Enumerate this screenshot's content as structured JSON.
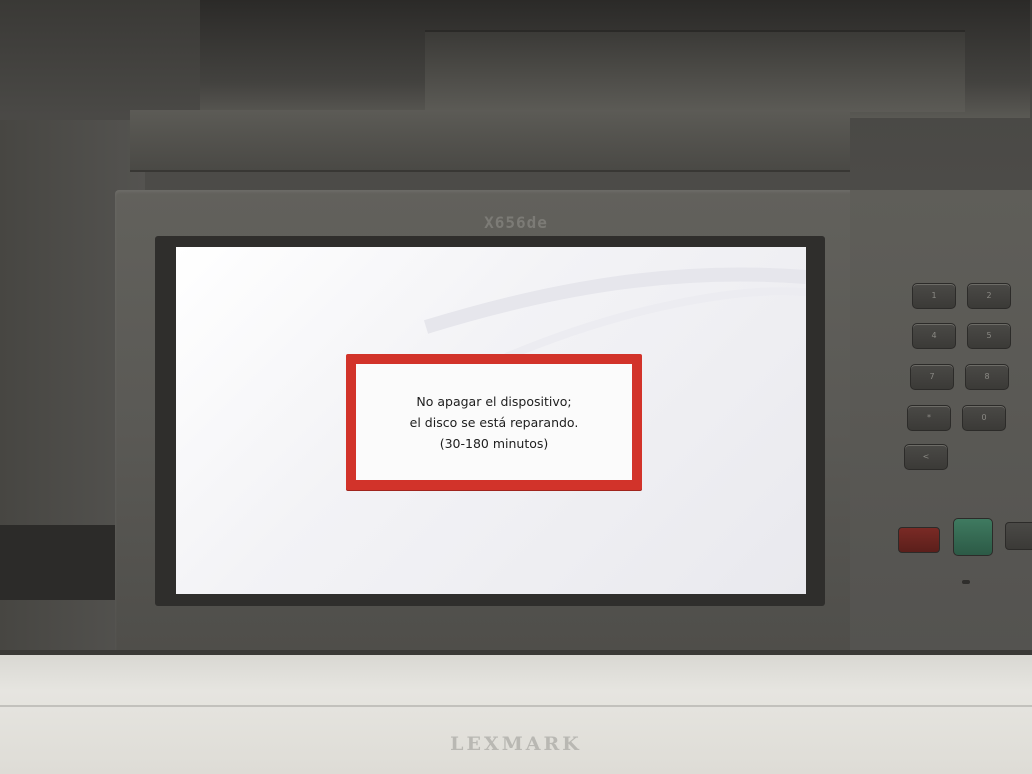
{
  "device": {
    "model_label": "X656de",
    "brand": "LEXMARK"
  },
  "screen": {
    "message": {
      "line1": "No apagar el dispositivo;",
      "line2": "el disco se está reparando.",
      "line3": "(30-180 minutos)"
    },
    "dialog_border_color": "#d2332a"
  },
  "keypad": {
    "keys": [
      "1",
      "2",
      "4",
      "5",
      "7",
      "8",
      "*",
      "0",
      "<"
    ],
    "stop_color": "#7a2a25",
    "go_color": "#3f7a60"
  }
}
